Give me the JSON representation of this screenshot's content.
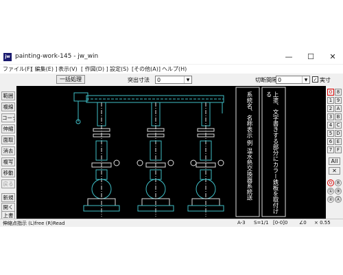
{
  "window": {
    "title": "painting-work-145 - jw_win",
    "icon_label": "jw",
    "minimize_glyph": "—",
    "maximize_glyph": "☐",
    "close_glyph": "✕"
  },
  "menu": [
    "ファイル(F)",
    "[ 編集(E) ]",
    "表示(V)",
    "[ 作図(D) ]",
    "設定(S)",
    "[その他(A)]",
    "ヘルプ(H)"
  ],
  "toolbar": {
    "batch_button": "一括処理",
    "protrusion_label": "突出寸法",
    "protrusion_value": "0",
    "gap_label": "切断間隔",
    "gap_value": "0",
    "actual_label": "実寸",
    "actual_checked": "✓"
  },
  "left_tools": [
    "範囲",
    "複線",
    "コーナー",
    "伸縮",
    "面取",
    "消去",
    "複写",
    "移動",
    "戻る",
    "新規",
    "開く",
    "上書"
  ],
  "right_tools": {
    "row0": [
      "0",
      "8"
    ],
    "rows": [
      [
        "1",
        "9"
      ],
      [
        "2",
        "A"
      ],
      [
        "3",
        "B"
      ],
      [
        "4",
        "C"
      ],
      [
        "5",
        "D"
      ],
      [
        "6",
        "E"
      ],
      [
        "7",
        "F"
      ]
    ],
    "all_label": "All",
    "x_label": "✕",
    "circle_row": [
      "0",
      "8"
    ],
    "bottom_row": [
      "①",
      "⑨"
    ],
    "last_row": [
      "②",
      "Ⓐ"
    ]
  },
  "drawing": {
    "annotation_1": "系統名、名称表示 例 温水熱交換器系統送",
    "annotation_2": "上塗、文字書きする部分にカラー鉄板を取付ける"
  },
  "status": {
    "hint": "伸縮点指示 (L)free (R)Read",
    "paper": "A-3",
    "scale": "S=1/1",
    "layer": "[0-0]0",
    "angle": "∠0",
    "zoom": "× 0.55"
  }
}
